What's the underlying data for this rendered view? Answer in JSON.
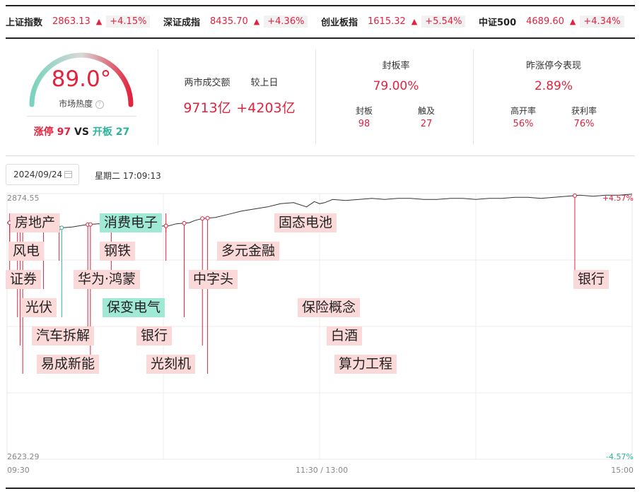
{
  "indices": [
    {
      "name": "上证指数",
      "value": "2863.13",
      "change": "+4.15%"
    },
    {
      "name": "深证成指",
      "value": "8435.70",
      "change": "+4.36%"
    },
    {
      "name": "创业板指",
      "value": "1615.32",
      "change": "+5.54%"
    },
    {
      "name": "中证500",
      "value": "4689.60",
      "change": "+4.34%"
    }
  ],
  "gauge": {
    "value": "89.0°",
    "label": "市场热度",
    "limit_up_label": "涨停",
    "limit_up": "97",
    "vs": "VS",
    "open_label": "开板",
    "open": "27",
    "level_pct": 89
  },
  "turnover": {
    "label": "两市成交额",
    "value": "9713亿",
    "diff_label": "较上日",
    "diff": "+4203亿"
  },
  "seal": {
    "label": "封板率",
    "value": "79.00%",
    "sealed_label": "封板",
    "sealed": "98",
    "touched_label": "触及",
    "touched": "27"
  },
  "yesterday": {
    "label": "昨涨停今表现",
    "value": "2.89%",
    "high_open_label": "高开率",
    "high_open": "56%",
    "profit_label": "获利率",
    "profit": "76%"
  },
  "date": {
    "date": "2024/09/24",
    "weekday_time": "星期二 17:09:13"
  },
  "chart_data": {
    "type": "line",
    "y_top": "2874.55",
    "y_bottom": "2623.29",
    "pct_top": "+4.57%",
    "pct_bottom": "-4.57%",
    "x_labels": [
      "09:30",
      "11:30 / 13:00",
      "15:00"
    ],
    "colors": {
      "line": "#333333",
      "marker": "#e2233e",
      "tag_red": "#fbd9d9",
      "tag_green": "#9fe9d5"
    },
    "series": [
      {
        "x": [
          0,
          1,
          2,
          3,
          4,
          5,
          7,
          10,
          15,
          20,
          25,
          30,
          35,
          40,
          45,
          50,
          55,
          60,
          62,
          65,
          70,
          72,
          75,
          80,
          85,
          90,
          95,
          100,
          105,
          110,
          115,
          118,
          120,
          122,
          125,
          130,
          135,
          140,
          145,
          150,
          155,
          160,
          165,
          170,
          175,
          180,
          185,
          190,
          195,
          200,
          205,
          210,
          215,
          220,
          225,
          230,
          235,
          240
        ],
        "values": [
          2847,
          2847,
          2849,
          2846,
          2849,
          2848,
          2845,
          2846,
          2843,
          2842,
          2843,
          2845,
          2846,
          2846,
          2844,
          2841,
          2842,
          2844,
          2844,
          2846,
          2847,
          2849,
          2851,
          2852,
          2855,
          2858,
          2860,
          2862,
          2865,
          2866,
          2862,
          2867,
          2865,
          2866,
          2869,
          2868,
          2869,
          2870,
          2869,
          2870,
          2870,
          2869,
          2869,
          2870,
          2870,
          2869,
          2870,
          2870,
          2871,
          2871,
          2870,
          2871,
          2872,
          2873,
          2872,
          2873,
          2873,
          2874
        ]
      }
    ],
    "annotations": [
      {
        "text": "房地产",
        "t": 1,
        "color": "red"
      },
      {
        "text": "风电",
        "t": 1,
        "color": "red"
      },
      {
        "text": "证券",
        "t": 1,
        "color": "red"
      },
      {
        "text": "光伏",
        "t": 4,
        "color": "red"
      },
      {
        "text": "汽车拆解",
        "t": 5,
        "color": "red"
      },
      {
        "text": "易成新能",
        "t": 6,
        "color": "red"
      },
      {
        "text": "华为·鸿蒙",
        "t": 14,
        "color": "red"
      },
      {
        "text": "消费电子",
        "t": 20,
        "color": "green"
      },
      {
        "text": "钢铁",
        "t": 20,
        "color": "red"
      },
      {
        "text": "保变电气",
        "t": 21,
        "color": "green"
      },
      {
        "text": "银行",
        "t": 31,
        "color": "red"
      },
      {
        "text": "光刻机",
        "t": 32,
        "color": "red"
      },
      {
        "text": "中字头",
        "t": 40,
        "color": "red"
      },
      {
        "text": "多元金融",
        "t": 61,
        "color": "red"
      },
      {
        "text": "固态电池",
        "t": 61,
        "color": "red"
      },
      {
        "text": "保险概念",
        "t": 68,
        "color": "red"
      },
      {
        "text": "白酒",
        "t": 75,
        "color": "red"
      },
      {
        "text": "算力工程",
        "t": 77,
        "color": "red"
      },
      {
        "text": "银行",
        "t": 218,
        "color": "red"
      }
    ]
  }
}
